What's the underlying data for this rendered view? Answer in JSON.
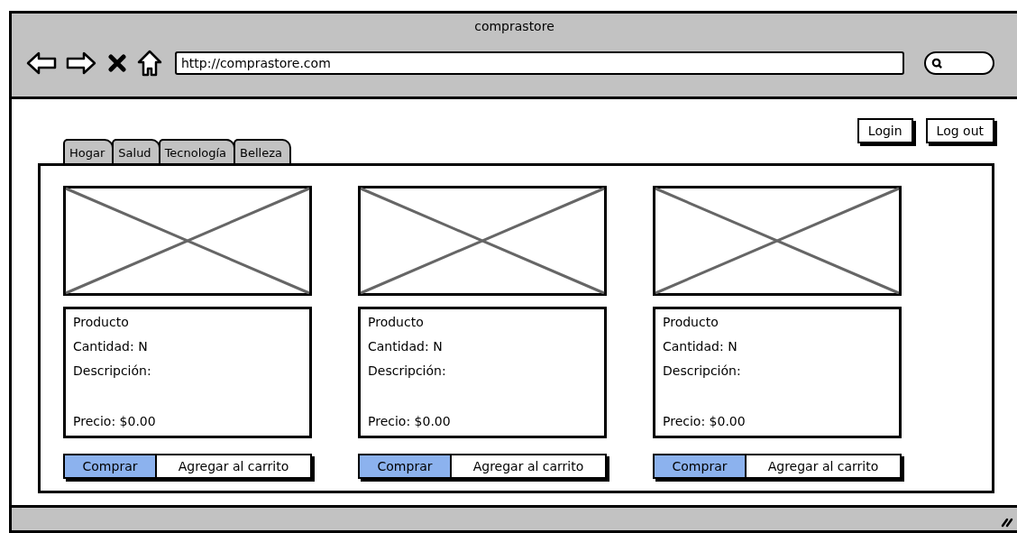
{
  "window": {
    "title": "comprastore",
    "url": "http://comprastore.com"
  },
  "auth_buttons": [
    "Login",
    "Log out"
  ],
  "tabs": [
    {
      "label": "Hogar",
      "selected": false
    },
    {
      "label": "Salud",
      "selected": false
    },
    {
      "label": "Tecnología",
      "selected": false
    },
    {
      "label": "Belleza",
      "selected": false
    }
  ],
  "products": [
    {
      "name": "Producto",
      "quantity": "Cantidad: N",
      "description": "Descripción:",
      "price": "Precio: $0.00",
      "actions": [
        {
          "label": "Comprar",
          "selected": true
        },
        {
          "label": "Agregar al carrito",
          "selected": false
        }
      ]
    },
    {
      "name": "Producto",
      "quantity": "Cantidad: N",
      "description": "Descripción:",
      "price": "Precio: $0.00",
      "actions": [
        {
          "label": "Comprar",
          "selected": true
        },
        {
          "label": "Agregar al carrito",
          "selected": false
        }
      ]
    },
    {
      "name": "Producto",
      "quantity": "Cantidad: N",
      "description": "Descripción:",
      "price": "Precio: $0.00",
      "actions": [
        {
          "label": "Comprar",
          "selected": true
        },
        {
          "label": "Agregar al carrito",
          "selected": false
        }
      ]
    }
  ]
}
